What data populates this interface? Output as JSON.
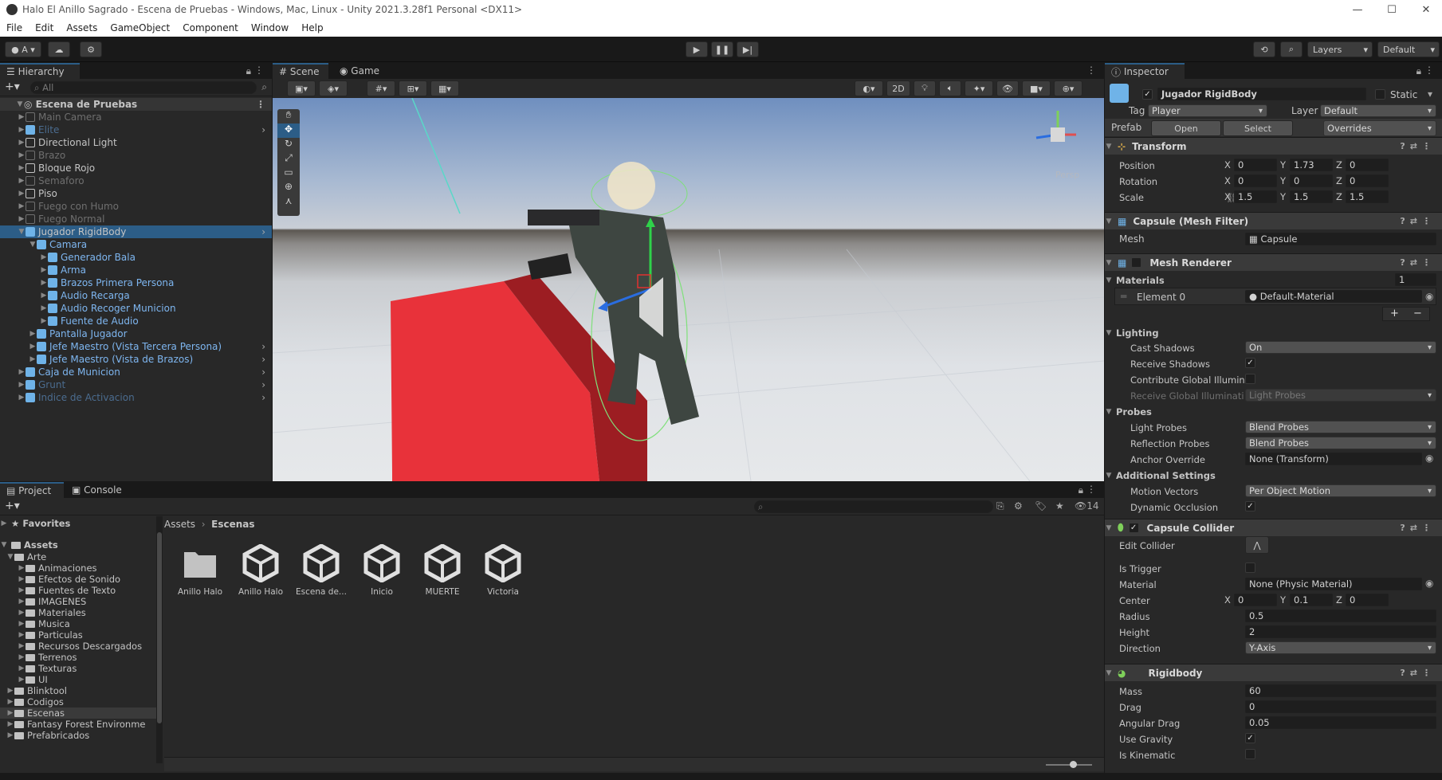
{
  "window": {
    "title": "Halo El Anillo Sagrado - Escena de Pruebas - Windows, Mac, Linux - Unity 2021.3.28f1 Personal <DX11>"
  },
  "menu": [
    "File",
    "Edit",
    "Assets",
    "GameObject",
    "Component",
    "Window",
    "Help"
  ],
  "toolbar": {
    "account": "A",
    "layers": "Layers",
    "layout": "Default"
  },
  "hierarchy": {
    "tab": "Hierarchy",
    "search_placeholder": "All",
    "scene": "Escena de Pruebas",
    "items": [
      {
        "label": "Main Camera",
        "depth": 1,
        "style": "dim"
      },
      {
        "label": "Elite",
        "depth": 1,
        "style": "dimprefab"
      },
      {
        "label": "Directional Light",
        "depth": 1,
        "style": "normal"
      },
      {
        "label": "Brazo",
        "depth": 1,
        "style": "dim"
      },
      {
        "label": "Bloque Rojo",
        "depth": 1,
        "style": "normal"
      },
      {
        "label": "Semaforo",
        "depth": 1,
        "style": "dim"
      },
      {
        "label": "Piso",
        "depth": 1,
        "style": "normal"
      },
      {
        "label": "Fuego con Humo",
        "depth": 1,
        "style": "dim"
      },
      {
        "label": "Fuego Normal",
        "depth": 1,
        "style": "dim"
      },
      {
        "label": "Jugador RigidBody",
        "depth": 1,
        "style": "selected"
      },
      {
        "label": "Camara",
        "depth": 2,
        "style": "prefab"
      },
      {
        "label": "Generador Bala",
        "depth": 3,
        "style": "prefab"
      },
      {
        "label": "Arma",
        "depth": 3,
        "style": "prefab"
      },
      {
        "label": "Brazos Primera Persona",
        "depth": 3,
        "style": "prefab"
      },
      {
        "label": "Audio Recarga",
        "depth": 3,
        "style": "prefab"
      },
      {
        "label": "Audio Recoger Municion",
        "depth": 3,
        "style": "prefab"
      },
      {
        "label": "Fuente de Audio",
        "depth": 3,
        "style": "prefab"
      },
      {
        "label": "Pantalla Jugador",
        "depth": 2,
        "style": "prefab"
      },
      {
        "label": "Jefe Maestro (Vista Tercera Persona)",
        "depth": 2,
        "style": "prefab"
      },
      {
        "label": "Jefe Maestro (Vista de Brazos)",
        "depth": 2,
        "style": "prefab"
      },
      {
        "label": "Caja de Municion",
        "depth": 1,
        "style": "prefab"
      },
      {
        "label": "Grunt",
        "depth": 1,
        "style": "dimprefab"
      },
      {
        "label": "Indice de Activacion",
        "depth": 1,
        "style": "dimprefab"
      }
    ]
  },
  "scene_view": {
    "tab_scene": "Scene",
    "tab_game": "Game",
    "btn_2d": "2D",
    "persp": "Persp"
  },
  "project": {
    "tab_project": "Project",
    "tab_console": "Console",
    "hidden_count": "14",
    "favorites": "Favorites",
    "assets": "Assets",
    "folders": [
      {
        "label": "Arte",
        "depth": 1
      },
      {
        "label": "Animaciones",
        "depth": 2
      },
      {
        "label": "Efectos de Sonido",
        "depth": 2
      },
      {
        "label": "Fuentes de Texto",
        "depth": 2
      },
      {
        "label": "IMAGENES",
        "depth": 2
      },
      {
        "label": "Materiales",
        "depth": 2
      },
      {
        "label": "Musica",
        "depth": 2
      },
      {
        "label": "Particulas",
        "depth": 2
      },
      {
        "label": "Recursos Descargados",
        "depth": 2
      },
      {
        "label": "Terrenos",
        "depth": 2
      },
      {
        "label": "Texturas",
        "depth": 2
      },
      {
        "label": "UI",
        "depth": 2
      },
      {
        "label": "Blinktool",
        "depth": 1
      },
      {
        "label": "Codigos",
        "depth": 1
      },
      {
        "label": "Escenas",
        "depth": 1
      },
      {
        "label": "Fantasy Forest Environme",
        "depth": 1
      },
      {
        "label": "Prefabricados",
        "depth": 1
      }
    ],
    "breadcrumb": [
      "Assets",
      "Escenas"
    ],
    "assets_grid": [
      "Anillo Halo",
      "Anillo Halo",
      "Escena de...",
      "Inicio",
      "MUERTE",
      "Victoria"
    ]
  },
  "inspector": {
    "tab": "Inspector",
    "object_name": "Jugador RigidBody",
    "static_label": "Static",
    "tag_label": "Tag",
    "tag": "Player",
    "layer_label": "Layer",
    "layer": "Default",
    "prefab_label": "Prefab",
    "open": "Open",
    "select": "Select",
    "overrides": "Overrides",
    "transform": {
      "title": "Transform",
      "position": "Position",
      "rotation": "Rotation",
      "scale": "Scale",
      "pos": [
        "0",
        "1.73",
        "0"
      ],
      "rot": [
        "0",
        "0",
        "0"
      ],
      "scl": [
        "1.5",
        "1.5",
        "1.5"
      ]
    },
    "mesh_filter": {
      "title": "Capsule (Mesh Filter)",
      "mesh_label": "Mesh",
      "mesh": "Capsule"
    },
    "mesh_renderer": {
      "title": "Mesh Renderer",
      "materials": "Materials",
      "materials_count": "1",
      "element0": "Element 0",
      "material": "Default-Material",
      "lighting": "Lighting",
      "cast_shadows": "Cast Shadows",
      "cast_val": "On",
      "receive_shadows": "Receive Shadows",
      "contribute_gi": "Contribute Global Illumin",
      "receive_gi": "Receive Global Illuminati",
      "receive_gi_val": "Light Probes",
      "probes": "Probes",
      "light_probes": "Light Probes",
      "light_probes_val": "Blend Probes",
      "reflection_probes": "Reflection Probes",
      "reflection_val": "Blend Probes",
      "anchor": "Anchor Override",
      "anchor_val": "None (Transform)",
      "additional": "Additional Settings",
      "motion": "Motion Vectors",
      "motion_val": "Per Object Motion",
      "dynamic": "Dynamic Occlusion"
    },
    "capsule": {
      "title": "Capsule Collider",
      "edit": "Edit Collider",
      "trigger": "Is Trigger",
      "material": "Material",
      "material_val": "None (Physic Material)",
      "center": "Center",
      "center_vals": [
        "0",
        "0.1",
        "0"
      ],
      "radius": "Radius",
      "radius_val": "0.5",
      "height": "Height",
      "height_val": "2",
      "direction": "Direction",
      "direction_val": "Y-Axis"
    },
    "rigidbody": {
      "title": "Rigidbody",
      "mass": "Mass",
      "mass_val": "60",
      "drag": "Drag",
      "drag_val": "0",
      "angular": "Angular Drag",
      "angular_val": "0.05",
      "gravity": "Use Gravity",
      "kinematic": "Is Kinematic"
    }
  },
  "colors": {
    "selection": "#2c5d87",
    "prefab_text": "#7eb6f0",
    "red_cube": "#e8323a"
  }
}
